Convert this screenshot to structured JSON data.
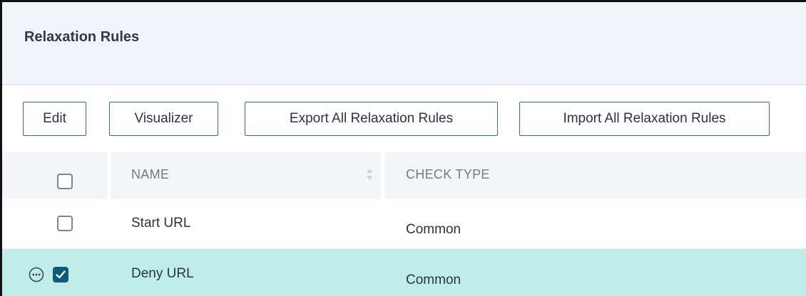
{
  "panel": {
    "title": "Relaxation Rules"
  },
  "toolbar": {
    "edit_label": "Edit",
    "visualizer_label": "Visualizer",
    "export_label": "Export All Relaxation Rules",
    "import_label": "Import All Relaxation Rules"
  },
  "table": {
    "columns": [
      "NAME",
      "CHECK TYPE"
    ],
    "rows": [
      {
        "name": "Start URL",
        "check_type": "Common",
        "selected": false
      },
      {
        "name": "Deny URL",
        "check_type": "Common",
        "selected": true
      }
    ]
  },
  "icons": {
    "sort": "sort-icon",
    "more": "more-options-icon",
    "check": "checkmark-icon"
  },
  "colors": {
    "accent": "#0c5a78",
    "button_border": "#2e6f86",
    "selected_row": "#bfeeea",
    "header_bg": "#f1f5fa",
    "column_header_bg": "#f3f5f8"
  }
}
